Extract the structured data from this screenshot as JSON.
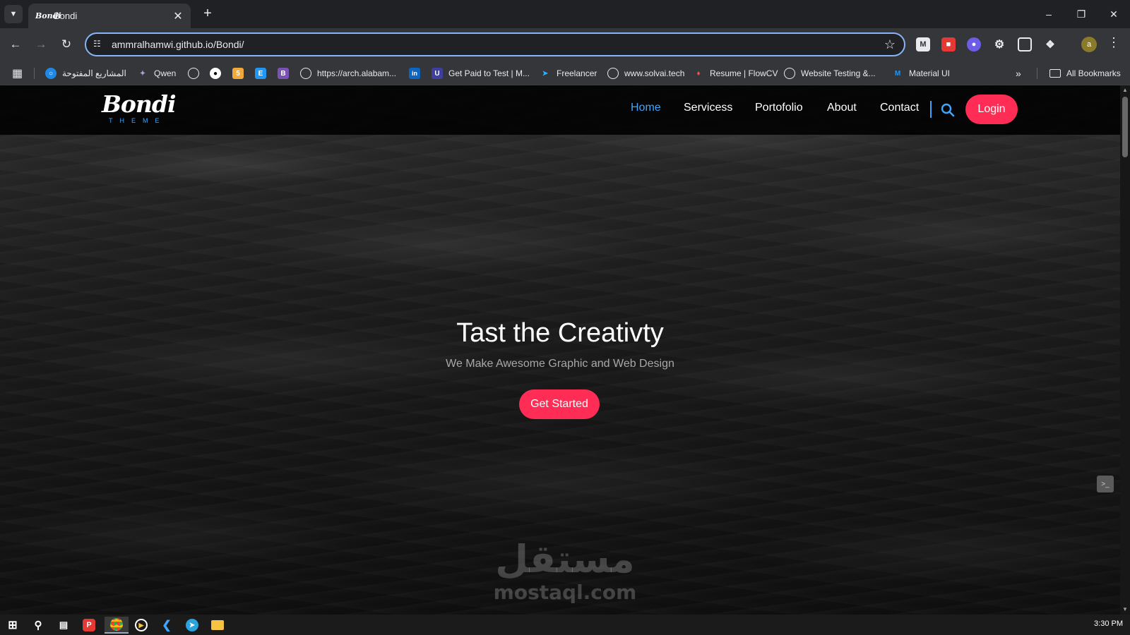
{
  "browser": {
    "tab": {
      "title": "Bondi",
      "favicon_text": "Bondi"
    },
    "address": {
      "url": "ammralhamwi.github.io/Bondi/"
    },
    "bookmarks": [
      {
        "label": "المشاريع المفتوحة",
        "icon": "mostaql-icon"
      },
      {
        "label": "Qwen",
        "icon": "qwen-icon"
      },
      {
        "label": "",
        "icon": "globe-icon"
      },
      {
        "label": "",
        "icon": "github-icon"
      },
      {
        "label": "",
        "icon": "html5-icon"
      },
      {
        "label": "",
        "icon": "elementor-icon"
      },
      {
        "label": "",
        "icon": "bootstrap-icon"
      },
      {
        "label": "https://arch.alabam...",
        "icon": "globe-icon"
      },
      {
        "label": "",
        "icon": "linkedin-icon"
      },
      {
        "label": "Get Paid to Test | M...",
        "icon": "utest-icon"
      },
      {
        "label": "Freelancer",
        "icon": "freelancer-icon"
      },
      {
        "label": "www.solvai.tech",
        "icon": "globe-icon"
      },
      {
        "label": "Resume | FlowCV",
        "icon": "flowcv-icon"
      },
      {
        "label": "Website Testing &...",
        "icon": "globe-icon"
      },
      {
        "label": "Material UI",
        "icon": "mui-icon"
      }
    ],
    "all_bookmarks_label": "All Bookmarks",
    "profile_initial": "a"
  },
  "site": {
    "logo": {
      "main": "Bondi",
      "sub": "THEME"
    },
    "nav": [
      {
        "label": "Home",
        "active": true
      },
      {
        "label": "Servicess",
        "active": false
      },
      {
        "label": "Portofolio",
        "active": false
      },
      {
        "label": "About",
        "active": false
      },
      {
        "label": "Contact",
        "active": false
      }
    ],
    "login_label": "Login",
    "hero": {
      "title": "Tast the Creativty",
      "subtitle": "We Make Awesome Graphic and Web Design",
      "cta_label": "Get Started"
    },
    "accent_color": "#3ea6ff",
    "cta_color": "#ff2d55"
  },
  "watermark": {
    "arabic": "مستقل",
    "latin": "mostaql.com"
  },
  "taskbar": {
    "clock": "3:30 PM"
  }
}
